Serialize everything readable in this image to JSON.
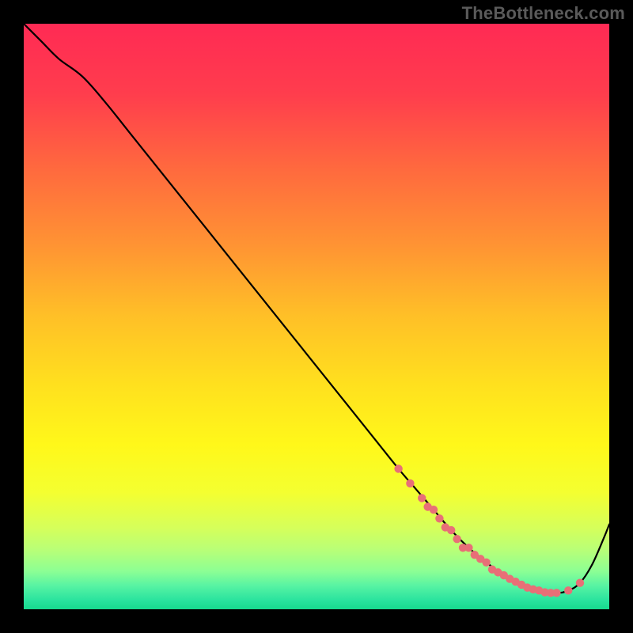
{
  "watermark": "TheBottleneck.com",
  "colors": {
    "curve": "#000000",
    "marker": "#e86f77",
    "frame_bg": "#000000"
  },
  "gradient_stops": [
    {
      "offset": 0.0,
      "color": "#ff2a54"
    },
    {
      "offset": 0.12,
      "color": "#ff3d4d"
    },
    {
      "offset": 0.25,
      "color": "#ff6a3e"
    },
    {
      "offset": 0.38,
      "color": "#ff9433"
    },
    {
      "offset": 0.5,
      "color": "#ffc027"
    },
    {
      "offset": 0.62,
      "color": "#ffe11e"
    },
    {
      "offset": 0.72,
      "color": "#fff81a"
    },
    {
      "offset": 0.8,
      "color": "#f4ff30"
    },
    {
      "offset": 0.86,
      "color": "#d6ff5a"
    },
    {
      "offset": 0.9,
      "color": "#b7ff78"
    },
    {
      "offset": 0.935,
      "color": "#8cff94"
    },
    {
      "offset": 0.96,
      "color": "#57f3a3"
    },
    {
      "offset": 0.985,
      "color": "#29e39e"
    },
    {
      "offset": 1.0,
      "color": "#17d98e"
    }
  ],
  "chart_data": {
    "type": "line",
    "title": "",
    "xlabel": "",
    "ylabel": "",
    "xlim": [
      0,
      100
    ],
    "ylim": [
      0,
      100
    ],
    "grid": false,
    "legend": false,
    "series": [
      {
        "name": "curve",
        "x": [
          0,
          3,
          6,
          10,
          14,
          18,
          24,
          30,
          36,
          42,
          48,
          54,
          60,
          64,
          67,
          70,
          73,
          76,
          79,
          82,
          85,
          88,
          91,
          93,
          95,
          97,
          99,
          100
        ],
        "y": [
          100,
          97,
          94,
          91,
          86.5,
          81.5,
          74,
          66.5,
          59,
          51.5,
          44,
          36.5,
          29,
          24,
          20.5,
          17,
          13.5,
          10.5,
          8,
          5.8,
          4.2,
          3.2,
          2.8,
          3.2,
          4.5,
          7.5,
          12,
          14.5
        ]
      }
    ],
    "markers": {
      "name": "highlight-points",
      "x": [
        64,
        66,
        68,
        69,
        70,
        71,
        72,
        73,
        74,
        75,
        76,
        77,
        78,
        79,
        80,
        81,
        82,
        83,
        84,
        85,
        86,
        87,
        88,
        89,
        90,
        91,
        93,
        95
      ],
      "y": [
        24,
        21.5,
        19,
        17.5,
        17,
        15.5,
        14,
        13.5,
        12,
        10.5,
        10.5,
        9.3,
        8.6,
        8,
        6.8,
        6.3,
        5.8,
        5.2,
        4.7,
        4.2,
        3.7,
        3.4,
        3.2,
        2.9,
        2.8,
        2.8,
        3.2,
        4.5
      ]
    }
  }
}
